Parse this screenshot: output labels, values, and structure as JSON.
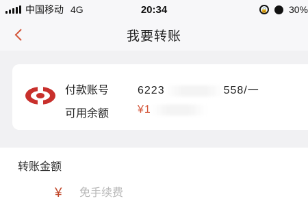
{
  "status_bar": {
    "carrier": "中国移动",
    "network": "4G",
    "time": "20:34",
    "battery": "30%"
  },
  "nav": {
    "title": "我要转账",
    "back_icon": "chevron-left-icon"
  },
  "colors": {
    "accent": "#d4573b",
    "logo_red": "#c8302c"
  },
  "account": {
    "payer_label": "付款账号",
    "payer_prefix": "6223",
    "payer_suffix": "558/一",
    "balance_label": "可用余额",
    "balance_prefix": "¥1"
  },
  "amount": {
    "title": "转账金额",
    "currency": "¥",
    "placeholder": "免手续费"
  }
}
